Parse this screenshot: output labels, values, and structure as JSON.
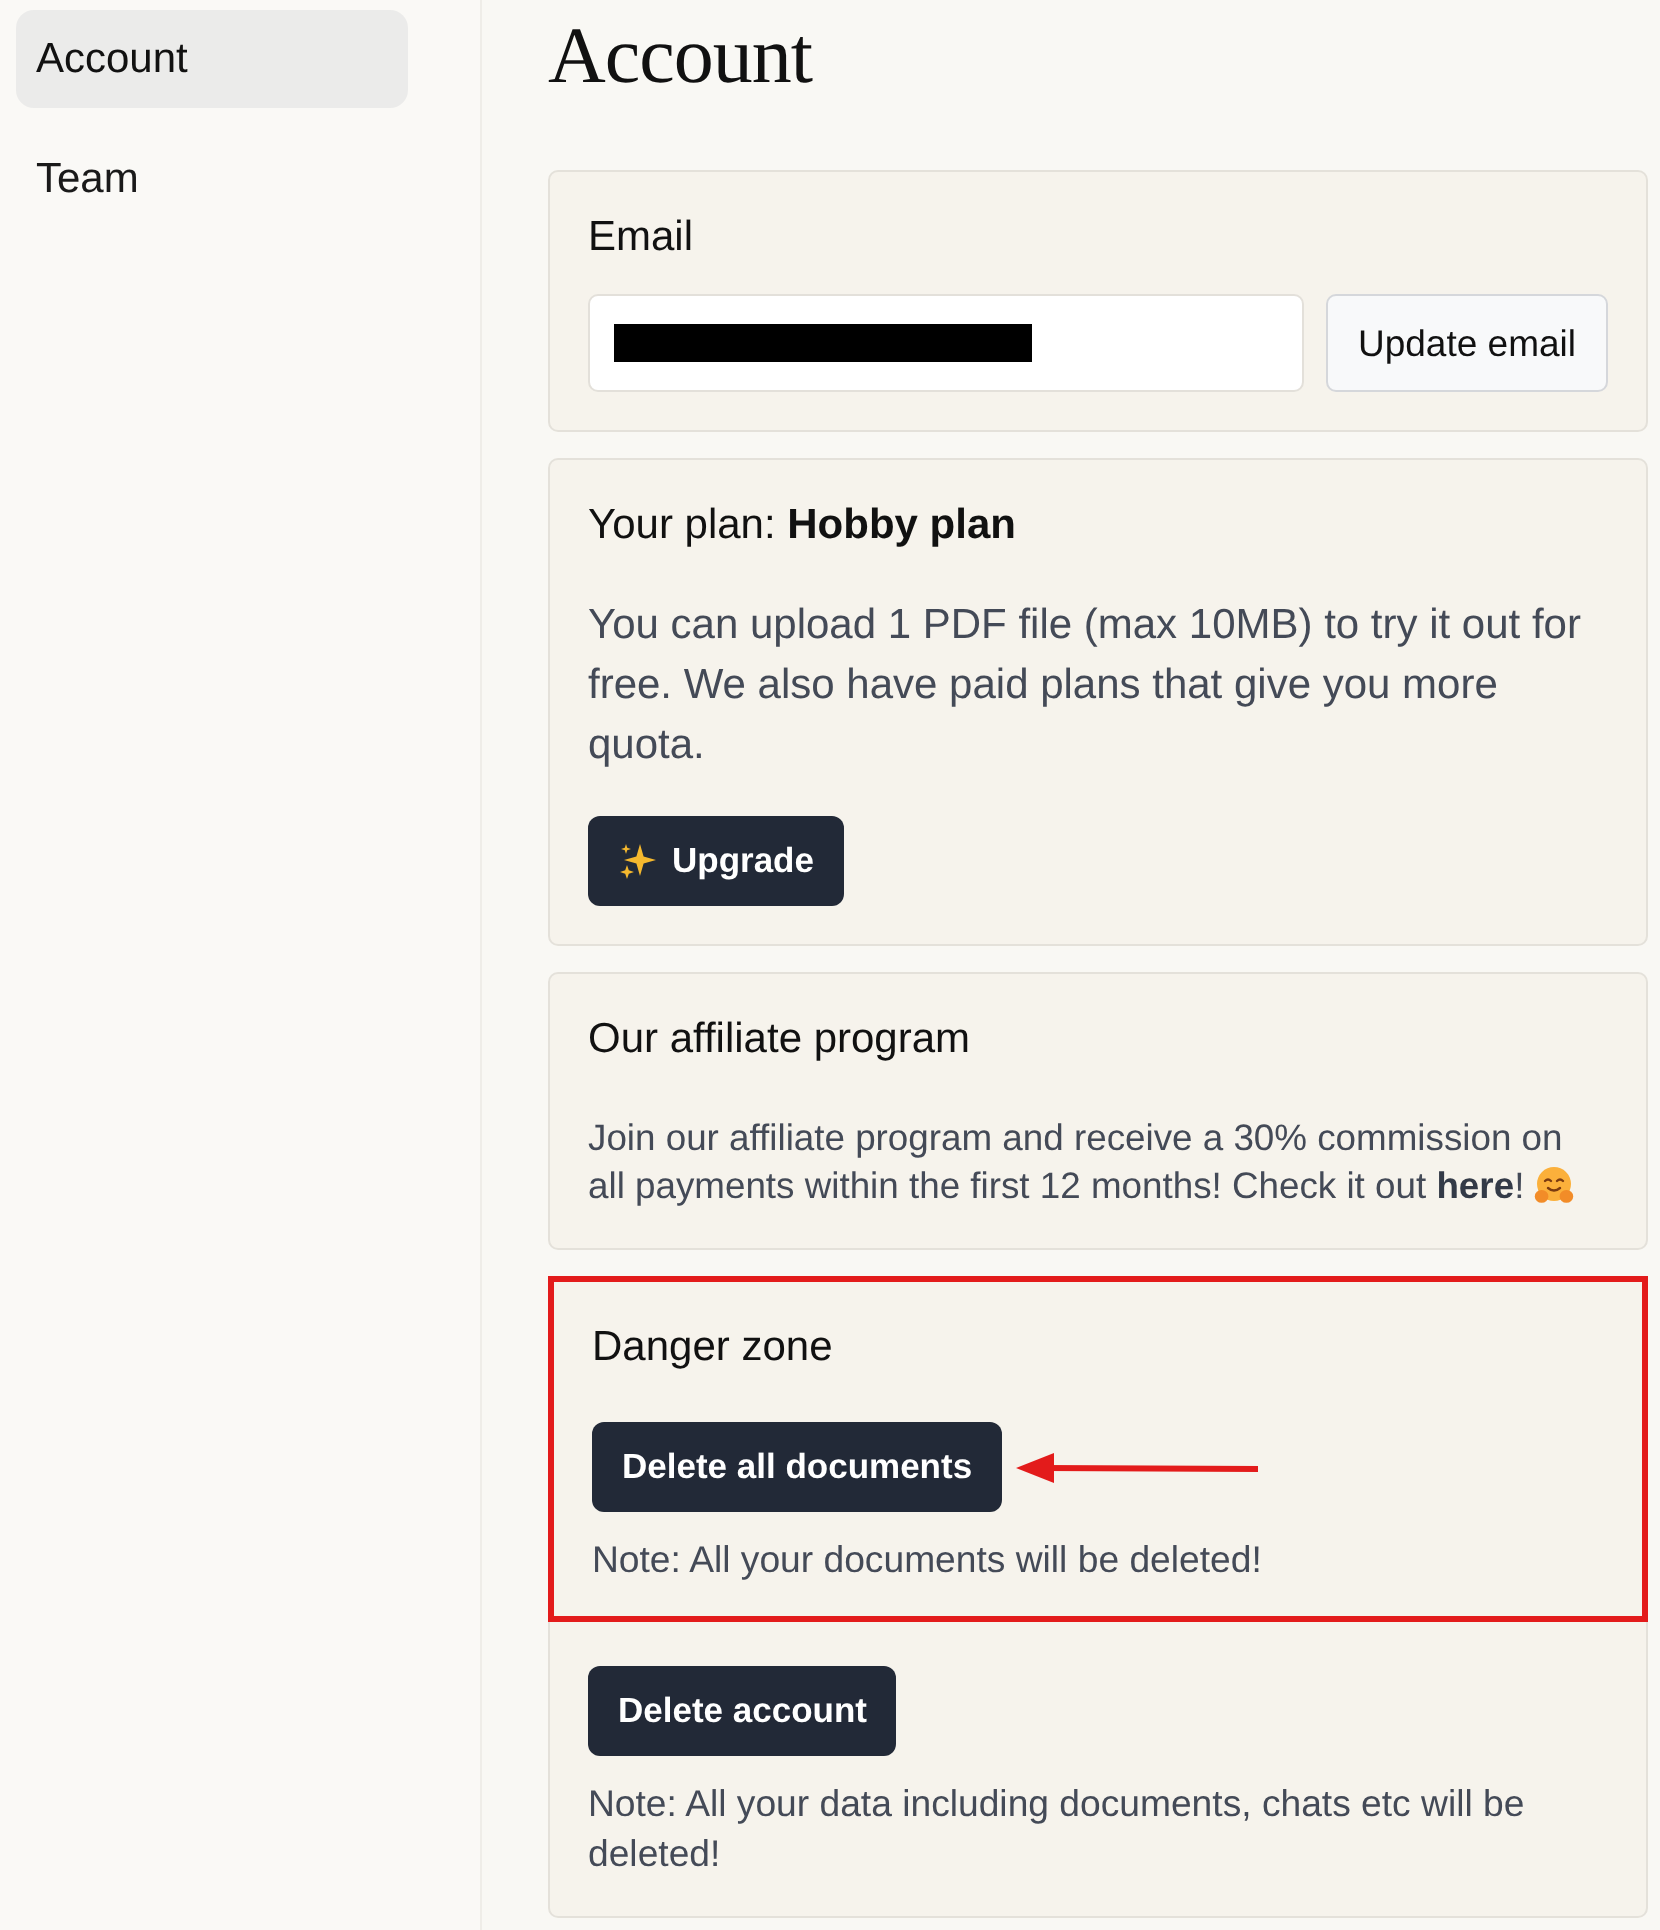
{
  "sidebar": {
    "items": [
      {
        "label": "Account",
        "selected": true
      },
      {
        "label": "Team",
        "selected": false
      }
    ]
  },
  "page": {
    "title": "Account"
  },
  "email_card": {
    "label": "Email",
    "value_redacted": true,
    "button": "Update email"
  },
  "plan_card": {
    "title": "Your plan: **Hobby plan**",
    "text": "You can upload 1 PDF file (max 10MB) to try it out for free. We also have paid plans that give you more quota.",
    "button": "Upgrade"
  },
  "affiliate_card": {
    "title": "Our affiliate program",
    "text": "Join our affiliate program and receive a 30% commission on all payments within the first 12 months! Check it out ",
    "link": "here",
    "text_after": "!"
  },
  "danger_zone": {
    "title": "Danger zone",
    "highlight_box": true,
    "pointer_arrow": true,
    "actions": [
      {
        "button": "Delete all documents",
        "note": "Note: All your documents will be deleted!"
      },
      {
        "button": "Delete account",
        "note": "Note: All your data including documents, chats etc will be deleted!"
      }
    ]
  }
}
